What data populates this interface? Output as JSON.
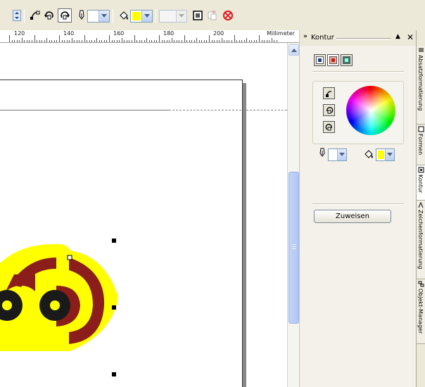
{
  "ruler": {
    "unit": "Millimeter",
    "labels": [
      "120",
      "140",
      "160",
      "180",
      "200"
    ]
  },
  "docker": {
    "title": "Kontur",
    "assign_label": "Zuweisen"
  },
  "vertical_tabs": [
    {
      "label": "Absatzformatierung",
      "active": false
    },
    {
      "label": "Formen",
      "active": false
    },
    {
      "label": "Kontur",
      "active": true
    },
    {
      "label": "Zeichenformatierung",
      "active": false
    },
    {
      "label": "Objekt-Manager",
      "active": false
    }
  ],
  "colors": {
    "fill": "#ffff00",
    "outline_swatch": "#ffff00",
    "logo_yellow": "#ffff00",
    "logo_brown": "#8b1e1a",
    "logo_black": "#1a1a1a",
    "accent_red": "#e02020"
  },
  "icons": {
    "cw_rotate": "rotate-icon",
    "pen": "pen-icon",
    "fill_bucket": "fill-bucket-icon",
    "close": "close-icon"
  }
}
